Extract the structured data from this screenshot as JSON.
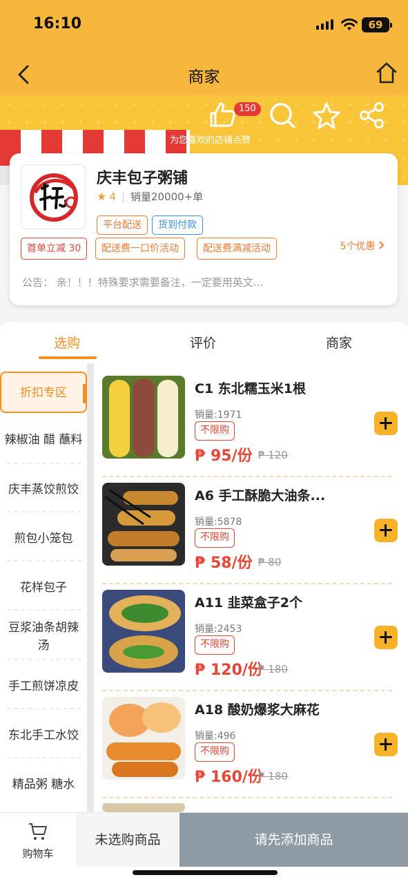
{
  "status_bar": {
    "time": "16:10",
    "battery": "69"
  },
  "nav": {
    "title": "商家",
    "back_icon": "chevron-left-icon",
    "home_icon": "home-icon"
  },
  "banner": {
    "like_count": "150",
    "like_hint": "为您喜欢的店铺点赞"
  },
  "shop": {
    "name": "庆丰包子粥铺",
    "rating": "4",
    "sales": "销量20000+单",
    "service_tags": [
      "平台配送",
      "货到付款"
    ],
    "promo_tags": [
      "首单立减 30",
      "配送费一口价活动",
      "配送费满减活动"
    ],
    "promos_link": "5个优惠",
    "notice_label": "公告：",
    "notice_text": "亲！！！特殊要求需要备注，一定要用英文..."
  },
  "tabs": [
    "选购",
    "评价",
    "商家"
  ],
  "categories": [
    "折扣专区",
    "辣椒油 醋 蘸料",
    "庆丰蒸饺煎饺",
    "煎包小笼包",
    "花样包子",
    "豆浆油条胡辣汤",
    "手工煎饼凉皮",
    "东北手工水饺",
    "精品粥 糖水"
  ],
  "products": [
    {
      "name": "C1 东北糯玉米1根",
      "sales": "销量:1971",
      "limit": "不限购",
      "price": "₱ 95/份",
      "original": "₱ 120"
    },
    {
      "name": "A6 手工酥脆大油条...",
      "sales": "销量:5878",
      "limit": "不限购",
      "price": "₱ 58/份",
      "original": "₱ 80"
    },
    {
      "name": "A11 韭菜盒子2个",
      "sales": "销量:2453",
      "limit": "不限购",
      "price": "₱ 120/份",
      "original": "₱ 180"
    },
    {
      "name": "A18 酸奶爆浆大麻花",
      "sales": "销量:496",
      "limit": "不限购",
      "price": "₱ 160/份",
      "original": "₱ 180"
    }
  ],
  "bottom_bar": {
    "cart_label": "购物车",
    "not_selected": "未选购商品",
    "checkout": "请先添加商品"
  },
  "colors": {
    "brand_yellow": "#f6b73c",
    "accent_orange": "#f09020",
    "price_red": "#e54636",
    "checkout_gray": "#8e9aa4"
  }
}
